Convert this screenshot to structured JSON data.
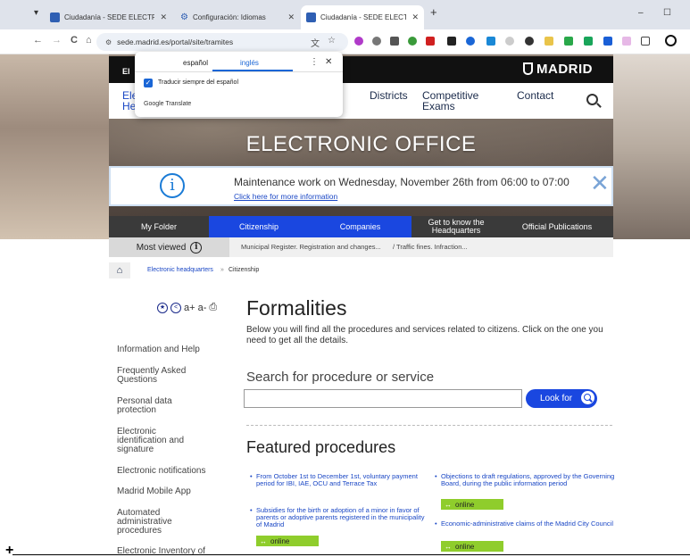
{
  "browser": {
    "tabs": [
      {
        "title": "Ciudadanía - SEDE ELECTRÓNI",
        "close": "✕"
      },
      {
        "title": "Configuración: Idiomas",
        "close": "✕"
      },
      {
        "title": "Ciudadanía - SEDE ELECTRÓNI",
        "close": "✕"
      }
    ],
    "new_tab": "+",
    "minimize": "–",
    "maximize": "☐",
    "tab_search": "▾",
    "url": "sede.madrid.es/portal/site/tramites",
    "nav": {
      "back": "←",
      "forward": "→",
      "reload": "C",
      "home": "⌂"
    },
    "translate_icon": "文",
    "star_icon": "☆"
  },
  "translate_popup": {
    "source_lang": "español",
    "target_lang": "inglés",
    "menu": "⋮",
    "close": "✕",
    "always_translate": "Traducir siempre del español",
    "brand": "Google Translate",
    "check": "✓"
  },
  "site": {
    "el_stub": "El",
    "logo": "MADRID",
    "menu": {
      "electronic_headquarters": [
        "Ele",
        "He"
      ],
      "districts": "Districts",
      "competitive_exams": [
        "Competitive",
        "Exams"
      ],
      "contact": "Contact"
    },
    "hero_title": "ELECTRONIC OFFICE",
    "notice": {
      "icon": "i",
      "message": "Maintenance work on Wednesday, November 26th from 06:00 to 07:00",
      "link": "Click here for more information",
      "close": "✕"
    },
    "nav": [
      {
        "label": "My Folder"
      },
      {
        "label": "Citizenship"
      },
      {
        "label": "Companies"
      },
      {
        "label": "Get to know the Headquarters"
      },
      {
        "label": "Official Publications"
      }
    ],
    "most_viewed": {
      "label": "Most viewed",
      "icon": "i",
      "links": [
        "Municipal Register. Registration and changes...",
        "/ Traffic fines. Infraction..."
      ]
    },
    "breadcrumb": {
      "home_icon": "⌂",
      "link": "Electronic headquarters",
      "sep": "»",
      "current": "Citizenship"
    },
    "tools": {
      "star": "★",
      "share": "<",
      "font": "a+ a-",
      "print": "⎙"
    },
    "sidebar": [
      {
        "label": "Information and Help"
      },
      {
        "label": "Frequently Asked Questions"
      },
      {
        "label": "Personal data protection"
      },
      {
        "label": "Electronic identification and signature"
      },
      {
        "label": "Electronic notifications"
      },
      {
        "label": "Madrid Mobile App"
      },
      {
        "label": "Automated administrative procedures"
      },
      {
        "label": "Electronic Inventory of"
      }
    ],
    "main": {
      "title": "Formalities",
      "intro": "Below you will find all the procedures and services related to citizens. Click on the one you need to get all the details.",
      "search_heading": "Search for procedure or service",
      "search_value": "",
      "look_for": "Look for",
      "featured_heading": "Featured procedures",
      "featured": [
        {
          "text": "From October 1st to December 1st, voluntary payment period for IBI, IAE, OCU and Terrace Tax"
        },
        {
          "text": "Subsidies for the birth or adoption of a minor in favor of parents or adoptive parents registered in the municipality of Madrid",
          "online": "online"
        },
        {
          "text": "Objections to draft regulations, approved by the Governing Board, during the public information period",
          "online": "online"
        },
        {
          "text": "Economic-administrative claims of the Madrid City Council",
          "online": "online"
        }
      ]
    }
  }
}
